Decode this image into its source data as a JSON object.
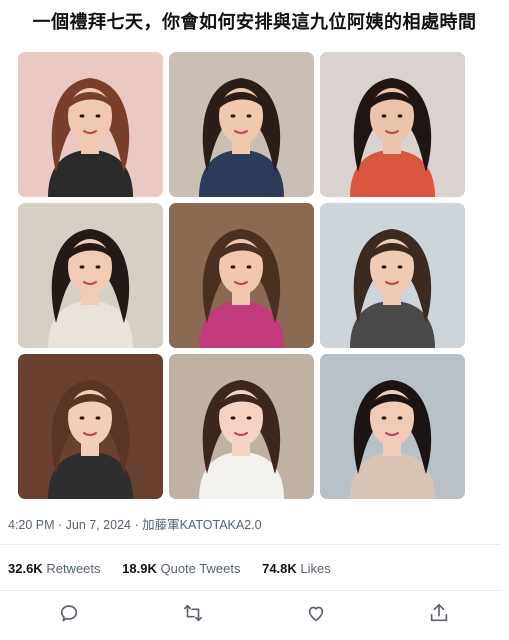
{
  "tweet": {
    "headline": "一個禮拜七天，你會如何安排與這九位阿姨的相處時間",
    "timestamp": "4:20 PM · Jun 7, 2024 · 加藤軍KATOTAKA2.0",
    "stats": [
      {
        "count": "32.6K",
        "label": "Retweets"
      },
      {
        "count": "18.9K",
        "label": "Quote Tweets"
      },
      {
        "count": "74.8K",
        "label": "Likes"
      }
    ]
  },
  "photos": [
    {
      "name": "photo-1",
      "bg": "#e9c9c1",
      "hair": "#7a3f2a",
      "skin": "#f1c9b3",
      "top": "#2a2a2a"
    },
    {
      "name": "photo-2",
      "bg": "#c9bfb4",
      "hair": "#2b1d18",
      "skin": "#efc8ad",
      "top": "#2c3b5a"
    },
    {
      "name": "photo-3",
      "bg": "#d9d2cf",
      "hair": "#1f1614",
      "skin": "#ecc4ab",
      "top": "#d9563f"
    },
    {
      "name": "photo-4",
      "bg": "#d6cfc6",
      "hair": "#231916",
      "skin": "#f0cbb6",
      "top": "#e9e3dc"
    },
    {
      "name": "photo-5",
      "bg": "#8a6a52",
      "hair": "#4a3020",
      "skin": "#f1c7ad",
      "top": "#c23a7a"
    },
    {
      "name": "photo-6",
      "bg": "#cdd4da",
      "hair": "#3a2a22",
      "skin": "#efcbb4",
      "top": "#4a4a4a"
    },
    {
      "name": "photo-7",
      "bg": "#6a4030",
      "hair": "#5a3525",
      "skin": "#f2cdb8",
      "top": "#2e2e30"
    },
    {
      "name": "photo-8",
      "bg": "#bfb2a4",
      "hair": "#3b2620",
      "skin": "#f4d3c2",
      "top": "#f4f2ef"
    },
    {
      "name": "photo-9",
      "bg": "#b9c1c8",
      "hair": "#1c1412",
      "skin": "#f0ccb7",
      "top": "#d7c4b4"
    }
  ],
  "actions": [
    {
      "name": "reply-icon"
    },
    {
      "name": "retweet-icon"
    },
    {
      "name": "like-icon"
    },
    {
      "name": "share-icon"
    }
  ]
}
